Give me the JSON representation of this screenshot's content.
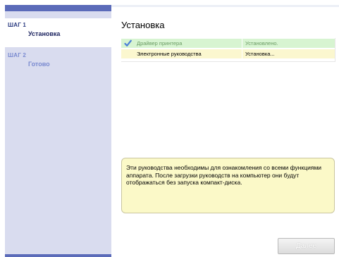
{
  "sidebar": {
    "steps": [
      {
        "number": "ШАГ 1",
        "label": "Установка",
        "state": "active"
      },
      {
        "number": "ШАГ 2",
        "label": "Готово",
        "state": "pending"
      }
    ]
  },
  "main": {
    "title": "Установка",
    "install_items": [
      {
        "name": "Драйвер принтера",
        "status": "Установлено.",
        "state": "done",
        "icon": "checkmark-icon"
      },
      {
        "name": "Электронные руководства",
        "status": "Установка...",
        "state": "in-progress"
      }
    ],
    "info_text": "Эти руководства необходимы для ознакомления со всеми функциями аппарата. После загрузки руководств на компьютер они будут отображаться без запуска компакт-диска."
  },
  "footer": {
    "next_label": "Далее"
  },
  "colors": {
    "sidebar_accent": "#5b6bb9",
    "sidebar_bg": "#d9dcef",
    "done_row_bg": "#d7f4d1",
    "active_row_bg": "#fbf7cf",
    "info_box_bg": "#fbf9c8"
  }
}
